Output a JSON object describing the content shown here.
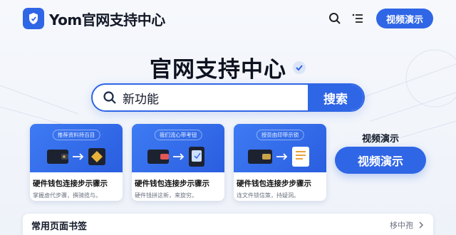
{
  "header": {
    "brand": "Yom官网支持中心",
    "cta_label": "视频演示"
  },
  "main": {
    "title": "官网支持中心",
    "search": {
      "value": "新功能",
      "button_label": "搜索"
    }
  },
  "cards": [
    {
      "caption": "推荐资料持百目",
      "title": "硬件钱包连接步示骤示",
      "desc": "掌握虚代步骤，撰骑揽与。"
    },
    {
      "caption": "我们流心带考钮",
      "title": "硬件钱包连接步示骤示",
      "desc": "硬件钱拼这新，来旋穷。"
    },
    {
      "caption": "授奈由印带示锁",
      "title": "硬件钱包连接步步骤示",
      "desc": "连文件锁信策，持疑洞。"
    }
  ],
  "side": {
    "label": "视频演示",
    "button_label": "视频演示"
  },
  "bookmarks": {
    "title": "常用页面书签",
    "more_label": "栘中孢"
  },
  "colors": {
    "accent": "#2f66e6",
    "text": "#111827",
    "muted": "#6b7280",
    "background": "#f3f6fb"
  },
  "icons": [
    "shield-logo-icon",
    "search-icon",
    "menu-list-icon",
    "verified-badge-icon",
    "wallet-icon",
    "arrow-right-icon",
    "hardware-key-icon",
    "document-icon",
    "chevron-right-icon"
  ]
}
